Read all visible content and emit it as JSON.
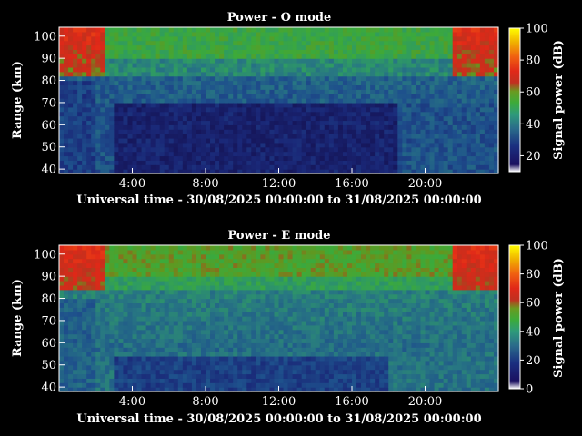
{
  "chart_data": [
    {
      "type": "heatmap",
      "title": "Power - O mode",
      "xlabel": "Universal time - 30/08/2025 00:00:00 to 31/08/2025 00:00:00",
      "ylabel": "Range (km)",
      "colorbar_label": "Signal power (dB)",
      "x_range_hours": [
        0,
        24
      ],
      "y_range_km": [
        38,
        104
      ],
      "x_ticks": [
        "4:00",
        "8:00",
        "12:00",
        "16:00",
        "20:00"
      ],
      "x_tick_values": [
        4,
        8,
        12,
        16,
        20
      ],
      "y_ticks": [
        "40",
        "50",
        "60",
        "70",
        "80",
        "90",
        "100"
      ],
      "y_tick_values": [
        40,
        50,
        60,
        70,
        80,
        90,
        100
      ],
      "colorbar_ticks": [
        "20",
        "40",
        "60",
        "80",
        "100"
      ],
      "colorbar_tick_values": [
        20,
        40,
        60,
        80,
        100
      ],
      "colorbar_range": [
        10,
        100
      ],
      "features": {
        "upper_layer_km": [
          82,
          104
        ],
        "upper_layer_peak_db": 62,
        "background_db": 22,
        "night_cavity_hours": [
          3,
          18.5
        ],
        "night_cavity_km": [
          38,
          70
        ]
      }
    },
    {
      "type": "heatmap",
      "title": "Power - E mode",
      "xlabel": "Universal time - 30/08/2025 00:00:00 to 31/08/2025 00:00:00",
      "ylabel": "Range (km)",
      "colorbar_label": "Signal power (dB)",
      "x_range_hours": [
        0,
        24
      ],
      "y_range_km": [
        38,
        104
      ],
      "x_ticks": [
        "4:00",
        "8:00",
        "12:00",
        "16:00",
        "20:00"
      ],
      "x_tick_values": [
        4,
        8,
        12,
        16,
        20
      ],
      "y_ticks": [
        "40",
        "50",
        "60",
        "70",
        "80",
        "90",
        "100"
      ],
      "y_tick_values": [
        40,
        50,
        60,
        70,
        80,
        90,
        100
      ],
      "colorbar_ticks": [
        "0",
        "20",
        "40",
        "60",
        "80",
        "100"
      ],
      "colorbar_tick_values": [
        0,
        20,
        40,
        60,
        80,
        100
      ],
      "colorbar_range": [
        0,
        100
      ],
      "features": {
        "upper_layer_km": [
          84,
          104
        ],
        "upper_layer_peak_db": 60,
        "background_db": 22,
        "night_cavity_hours": [
          3,
          18
        ],
        "night_cavity_km": [
          38,
          55
        ]
      }
    }
  ]
}
